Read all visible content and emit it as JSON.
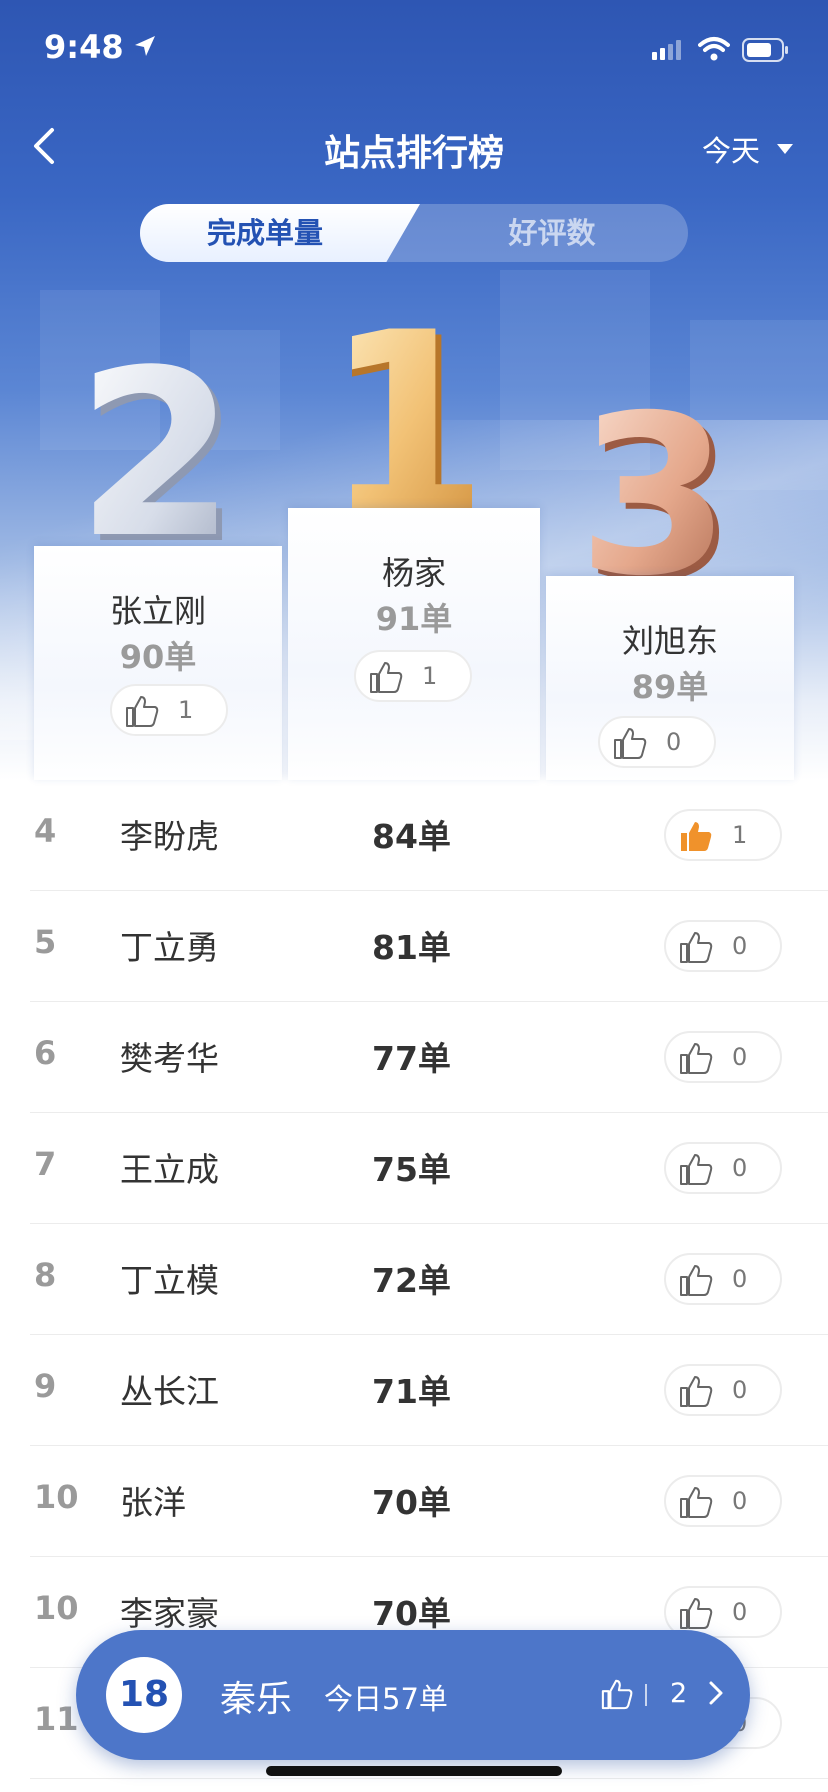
{
  "status_bar": {
    "time": "9:48"
  },
  "header": {
    "title": "站点排行榜",
    "date_filter": "今天"
  },
  "tabs": [
    {
      "label": "完成单量",
      "active": true
    },
    {
      "label": "好评数",
      "active": false
    }
  ],
  "podium": [
    {
      "rank": "1",
      "name": "杨家",
      "count": "91单",
      "likes": "1"
    },
    {
      "rank": "2",
      "name": "张立刚",
      "count": "90单",
      "likes": "1"
    },
    {
      "rank": "3",
      "name": "刘旭东",
      "count": "89单",
      "likes": "0"
    }
  ],
  "list": [
    {
      "rank": "4",
      "name": "李盼虎",
      "count": "84单",
      "likes": "1",
      "liked": true
    },
    {
      "rank": "5",
      "name": "丁立勇",
      "count": "81单",
      "likes": "0",
      "liked": false
    },
    {
      "rank": "6",
      "name": "樊考华",
      "count": "77单",
      "likes": "0",
      "liked": false
    },
    {
      "rank": "7",
      "name": "王立成",
      "count": "75单",
      "likes": "0",
      "liked": false
    },
    {
      "rank": "8",
      "name": "丁立模",
      "count": "72单",
      "likes": "0",
      "liked": false
    },
    {
      "rank": "9",
      "name": "丛长江",
      "count": "71单",
      "likes": "0",
      "liked": false
    },
    {
      "rank": "10",
      "name": "张洋",
      "count": "70单",
      "likes": "0",
      "liked": false
    },
    {
      "rank": "10",
      "name": "李家豪",
      "count": "70单",
      "likes": "0",
      "liked": false
    },
    {
      "rank": "11",
      "name": "",
      "count": "",
      "likes": "0",
      "liked": false
    }
  ],
  "my_rank": {
    "rank": "18",
    "name": "秦乐",
    "today": "今日57单",
    "likes": "2"
  },
  "colors": {
    "primary": "#2452b3",
    "bar": "#4d76c9",
    "liked": "#f0922b",
    "gold": "#e3a24a",
    "silver": "#c9cfdc",
    "bronze": "#d9957a"
  }
}
